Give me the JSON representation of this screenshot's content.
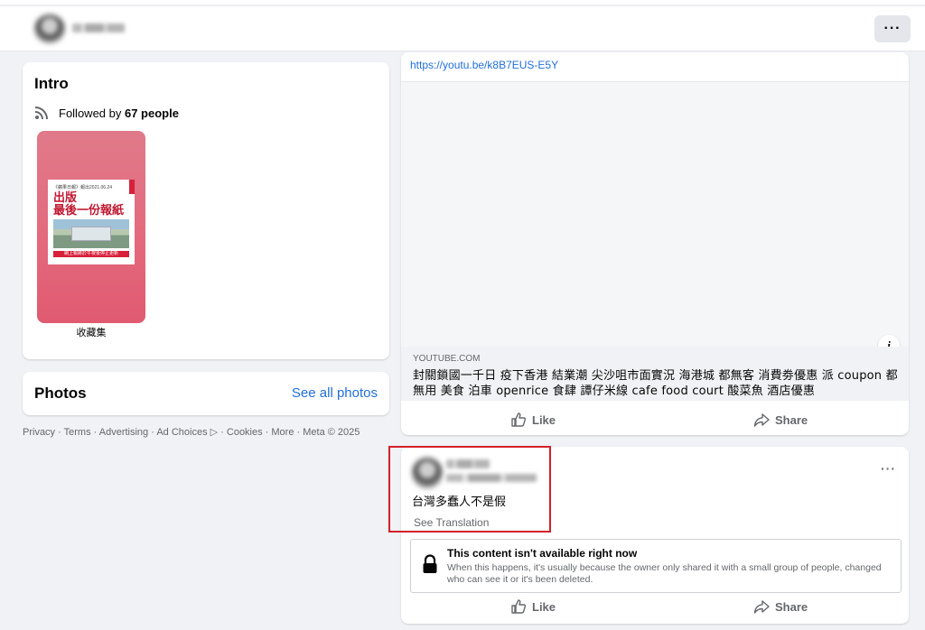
{
  "header": {
    "more_label": "···"
  },
  "intro": {
    "title": "Intro",
    "followed_prefix": "Followed by ",
    "followed_count": "67 people",
    "highlight": {
      "caption": "收藏集",
      "small_text": "《蘋果日報》報出2021.06.24",
      "big_text": "出版\n最後一份報紙",
      "strip_text": "網上報將於午夜後停止更新"
    }
  },
  "photos": {
    "title": "Photos",
    "see_all": "See all photos"
  },
  "footer": {
    "text": "Privacy · Terms · Advertising · Ad Choices ▷ · Cookies · More · Meta © 2025"
  },
  "post1": {
    "link": "https://youtu.be/k8B7EUS-E5Y",
    "info_icon": "i",
    "preview_domain": "YOUTUBE.COM",
    "preview_title": "封關鎖國一千日 疫下香港 結業潮 尖沙咀市面實況 海港城 都無客 消費劵優惠 派 coupon 都無用 美食 泊車 openrice 食肆 譚仔米線 cafe food court 酸菜魚 酒店優惠",
    "like_label": "Like",
    "share_label": "Share"
  },
  "post2": {
    "more_label": "···",
    "text": "台灣多蠢人不是假",
    "see_translation": "See Translation",
    "unavailable_title": "This content isn't available right now",
    "unavailable_desc": "When this happens, it's usually because the owner only shared it with a small group of people, changed who can see it or it's been deleted.",
    "like_label": "Like",
    "share_label": "Share"
  },
  "colors": {
    "link": "#216fdb",
    "highlight_box": "#d4202a",
    "muted": "#65676b"
  },
  "icons": [
    "rss-icon",
    "info-icon",
    "like-icon",
    "share-icon",
    "lock-icon",
    "more-icon"
  ]
}
